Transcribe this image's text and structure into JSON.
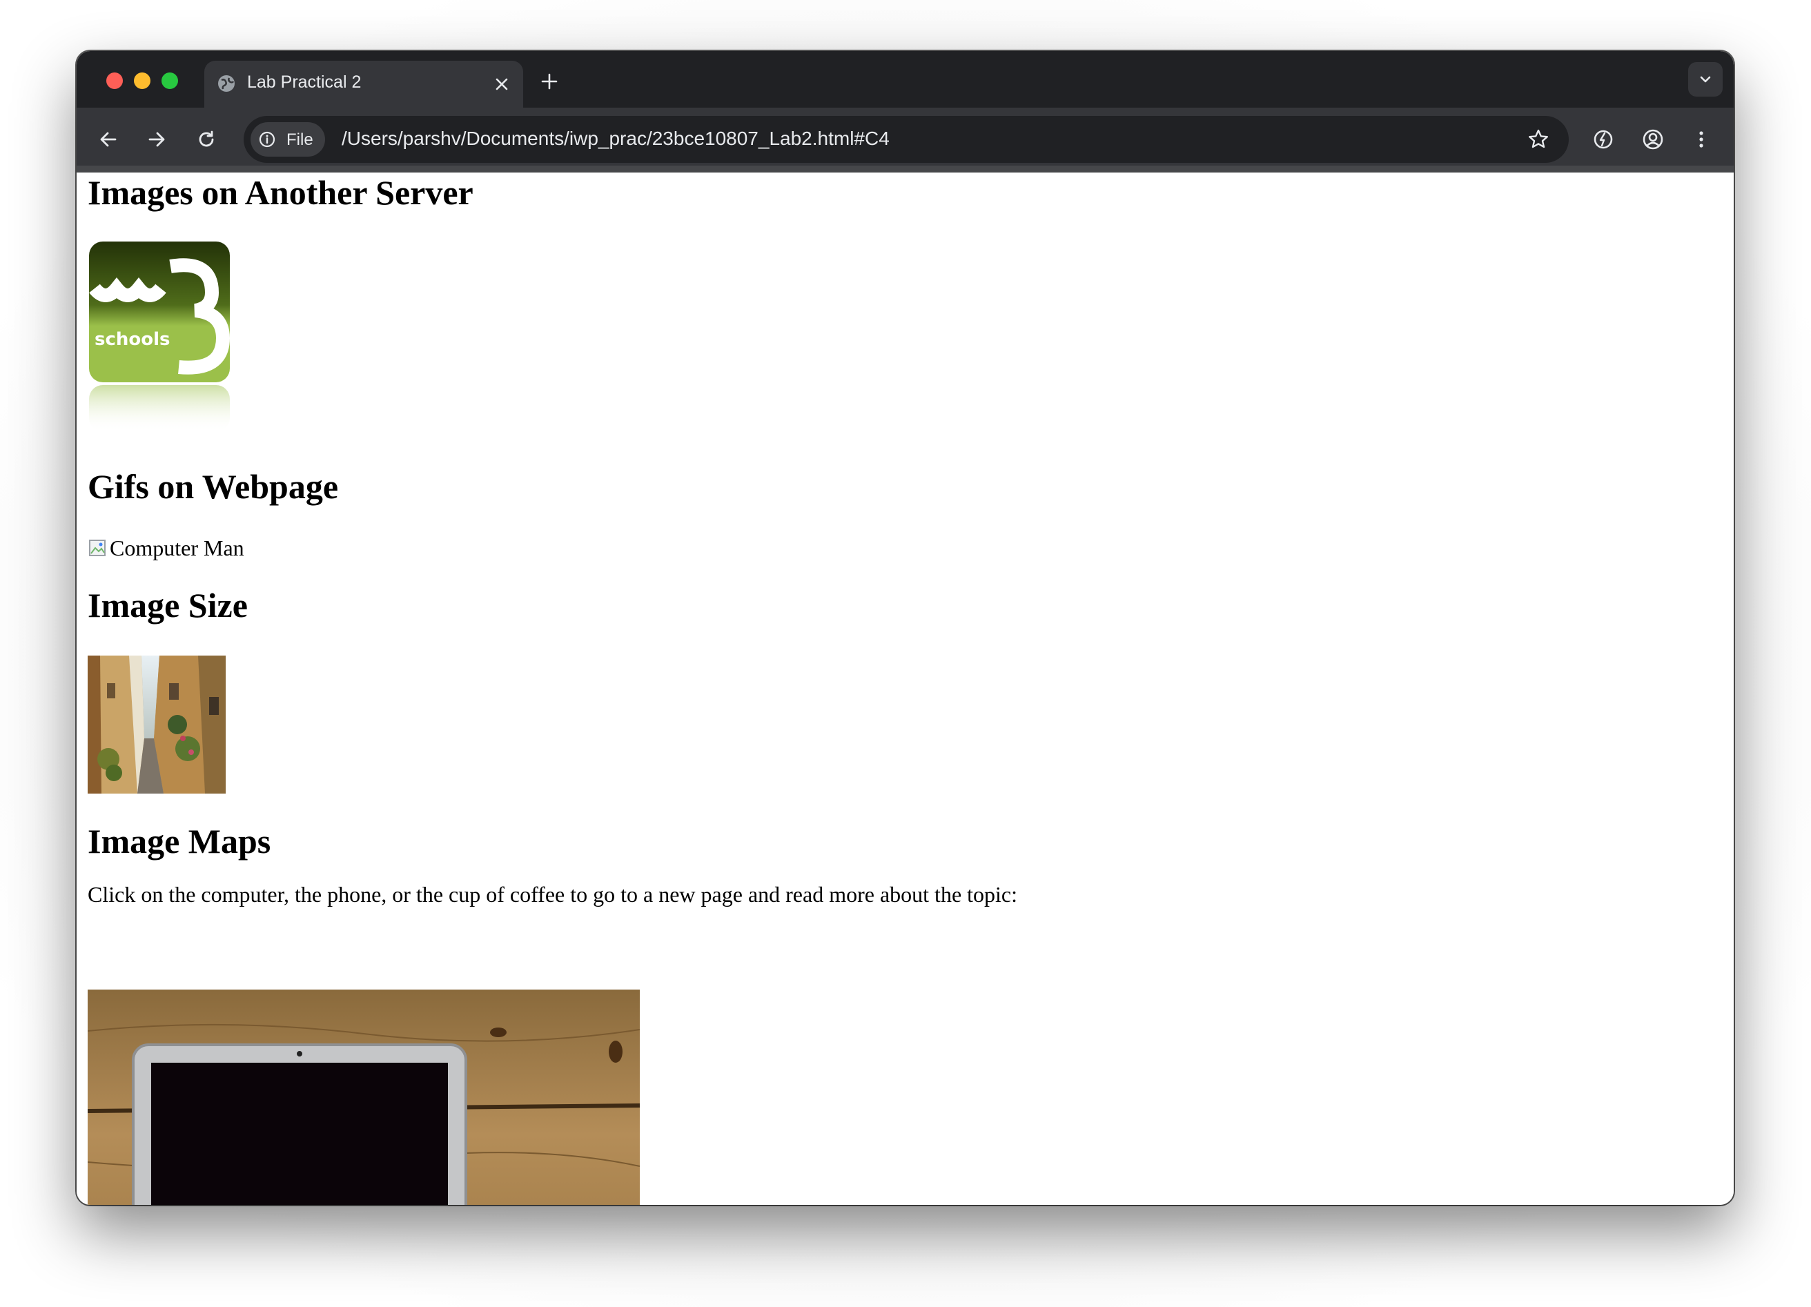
{
  "browser": {
    "tab_title": "Lab Practical 2",
    "site_chip_label": "File",
    "url": "/Users/parshv/Documents/iwp_prac/23bce10807_Lab2.html#C4",
    "icons": [
      "globe-icon",
      "close-icon",
      "plus-icon",
      "chevron-down-icon",
      "back-arrow-icon",
      "forward-arrow-icon",
      "reload-icon",
      "info-icon",
      "star-icon",
      "performance-icon",
      "profile-icon",
      "more-vert-icon"
    ]
  },
  "page": {
    "sections": {
      "another_server": {
        "heading": "Images on Another Server",
        "logo_text": "schools"
      },
      "gifs": {
        "heading": "Gifs on Webpage",
        "image_alt": "Computer Man"
      },
      "image_size": {
        "heading": "Image Size"
      },
      "image_maps": {
        "heading": "Image Maps",
        "instruction": "Click on the computer, the phone, or the cup of coffee to go to a new page and read more about the topic:"
      }
    }
  },
  "colors": {
    "tabstrip": "#202124",
    "toolbar": "#35363a",
    "text_light": "#e8eaed",
    "w3_green_dark": "#2c3d0e",
    "w3_green_light": "#9bc04a"
  }
}
